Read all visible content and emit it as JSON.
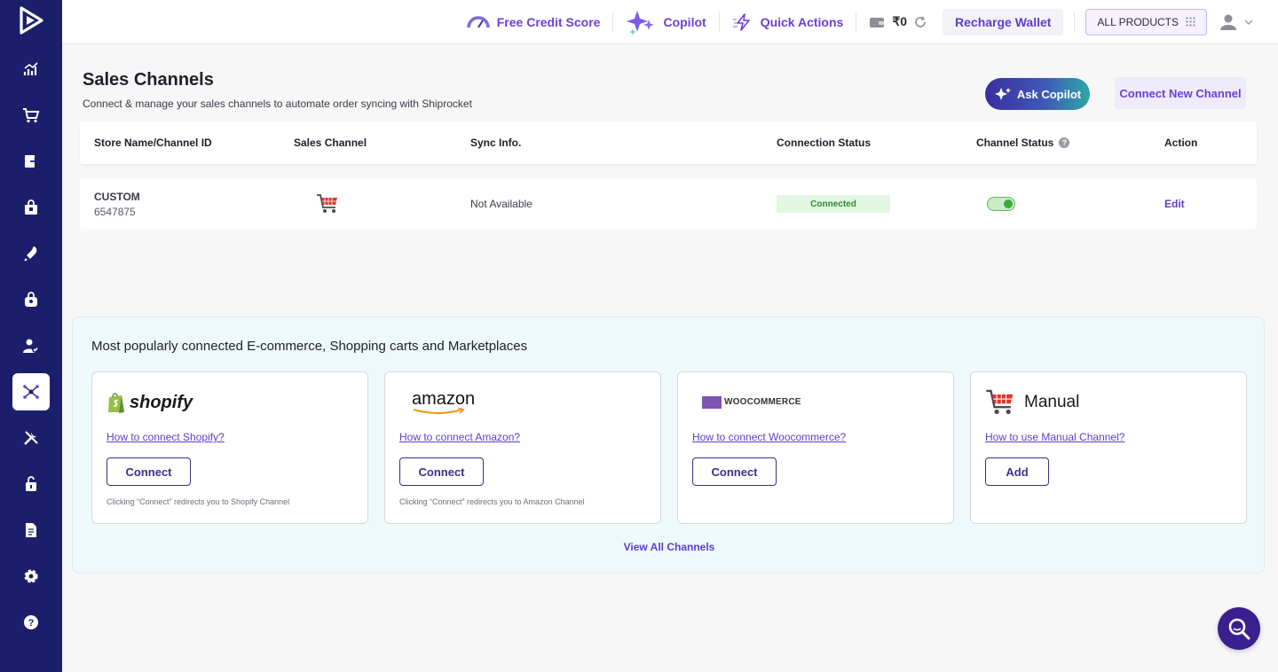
{
  "topbar": {
    "credit_score": "Free Credit Score",
    "copilot": "Copilot",
    "quick_actions": "Quick Actions",
    "wallet_balance": "₹0",
    "recharge": "Recharge Wallet",
    "all_products": "ALL PRODUCTS"
  },
  "header": {
    "title": "Sales Channels",
    "subtitle": "Connect & manage your sales channels to automate order syncing with Shiprocket",
    "ask_copilot": "Ask Copilot",
    "connect_new": "Connect New Channel"
  },
  "table": {
    "columns": [
      "Store Name/Channel ID",
      "Sales Channel",
      "Sync Info.",
      "Connection Status",
      "Channel Status",
      "Action"
    ],
    "rows": [
      {
        "store_name": "CUSTOM",
        "channel_id": "6547875",
        "sync_info": "Not Available",
        "connection_status": "Connected",
        "action": "Edit"
      }
    ]
  },
  "popular": {
    "title": "Most popularly connected E-commerce, Shopping carts and Marketplaces",
    "cards": [
      {
        "logo_text": "shopify",
        "link": "How to connect Shopify?",
        "button": "Connect",
        "note": "Clicking “Connect” redirects you to Shopify Channel"
      },
      {
        "logo_text": "amazon",
        "link": "How to connect Amazon?",
        "button": "Connect",
        "note": "Clicking “Connect” redirects you to Amazon Channel"
      },
      {
        "logo_text": "WOOCOMMERCE",
        "link": "How to connect Woocommerce?",
        "button": "Connect",
        "note": ""
      },
      {
        "logo_text": "Manual",
        "link": "How to use Manual Channel?",
        "button": "Add",
        "note": ""
      }
    ],
    "view_all": "View All Channels"
  },
  "colors": {
    "sidebar": "#1b1f6b",
    "accent": "#5e3ccf",
    "connected_bg": "#e3f6e1",
    "connected_text": "#2e8b2e"
  },
  "icons": [
    "play-logo-icon",
    "analytics-icon",
    "cart-icon",
    "returns-icon",
    "bag-icon",
    "rocket-icon",
    "lock-bag-icon",
    "user-check-icon",
    "channels-icon",
    "tools-icon",
    "lock-icon",
    "document-icon",
    "gear-icon",
    "help-icon",
    "search-icon"
  ]
}
